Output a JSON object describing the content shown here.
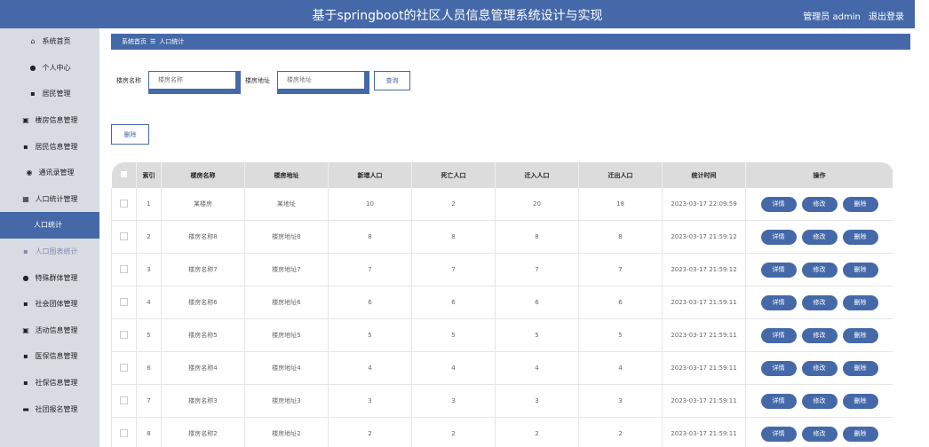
{
  "header": {
    "title": "基于springboot的社区人员信息管理系统设计与实现",
    "user_label": "管理员 admin",
    "logout": "退出登录"
  },
  "sidebar": {
    "items": [
      {
        "label": "系统首页",
        "icon": "home-icon",
        "glyph": "⌂"
      },
      {
        "label": "个人中心",
        "icon": "user-icon",
        "glyph": "●"
      },
      {
        "label": "居民管理",
        "icon": "grid-icon",
        "glyph": "▪"
      },
      {
        "label": "楼房信息管理",
        "icon": "building-icon",
        "glyph": "▣"
      },
      {
        "label": "居民信息管理",
        "icon": "grid-icon",
        "glyph": "▪"
      },
      {
        "label": "通讯录管理",
        "icon": "location-icon",
        "glyph": "◉"
      },
      {
        "label": "人口统计管理",
        "icon": "table-icon",
        "glyph": "▦"
      },
      {
        "label": "人口统计",
        "icon": "",
        "glyph": ""
      },
      {
        "label": "人口图表统计",
        "icon": "chart-icon",
        "glyph": "▪"
      },
      {
        "label": "特殊群体管理",
        "icon": "user-icon",
        "glyph": "●"
      },
      {
        "label": "社会团体管理",
        "icon": "grid-icon",
        "glyph": "▪"
      },
      {
        "label": "活动信息管理",
        "icon": "bag-icon",
        "glyph": "▣"
      },
      {
        "label": "医保信息管理",
        "icon": "grid-icon",
        "glyph": "▪"
      },
      {
        "label": "社保信息管理",
        "icon": "grid-icon",
        "glyph": "▪"
      },
      {
        "label": "社团报名管理",
        "icon": "card-icon",
        "glyph": "▬"
      }
    ]
  },
  "breadcrumb": {
    "home": "系统首页",
    "sep": "☰",
    "current": "人口统计"
  },
  "search": {
    "name_label": "楼房名称",
    "name_placeholder": "楼房名称",
    "address_label": "楼房地址",
    "address_placeholder": "楼房地址",
    "query_button": "查询"
  },
  "toolbar": {
    "delete_button": "删除"
  },
  "table": {
    "headers": [
      "",
      "索引",
      "楼房名称",
      "楼房地址",
      "新增人口",
      "死亡人口",
      "迁入人口",
      "迁出人口",
      "统计时间",
      "操作"
    ],
    "action_labels": {
      "detail": "详情",
      "edit": "修改",
      "delete": "删除"
    },
    "rows": [
      {
        "index": "1",
        "name": "某楼房",
        "address": "某地址",
        "new": "10",
        "death": "2",
        "in": "20",
        "out": "18",
        "time": "2023-03-17 22:09:59"
      },
      {
        "index": "2",
        "name": "楼房名称8",
        "address": "楼房地址8",
        "new": "8",
        "death": "8",
        "in": "8",
        "out": "8",
        "time": "2023-03-17 21:59:12"
      },
      {
        "index": "3",
        "name": "楼房名称7",
        "address": "楼房地址7",
        "new": "7",
        "death": "7",
        "in": "7",
        "out": "7",
        "time": "2023-03-17 21:59:12"
      },
      {
        "index": "4",
        "name": "楼房名称6",
        "address": "楼房地址6",
        "new": "6",
        "death": "6",
        "in": "6",
        "out": "6",
        "time": "2023-03-17 21:59:11"
      },
      {
        "index": "5",
        "name": "楼房名称5",
        "address": "楼房地址5",
        "new": "5",
        "death": "5",
        "in": "5",
        "out": "5",
        "time": "2023-03-17 21:59:11"
      },
      {
        "index": "6",
        "name": "楼房名称4",
        "address": "楼房地址4",
        "new": "4",
        "death": "4",
        "in": "4",
        "out": "4",
        "time": "2023-03-17 21:59:11"
      },
      {
        "index": "7",
        "name": "楼房名称3",
        "address": "楼房地址3",
        "new": "3",
        "death": "3",
        "in": "3",
        "out": "3",
        "time": "2023-03-17 21:59:11"
      },
      {
        "index": "8",
        "name": "楼房名称2",
        "address": "楼房地址2",
        "new": "2",
        "death": "2",
        "in": "2",
        "out": "2",
        "time": "2023-03-17 21:59:11"
      }
    ]
  }
}
